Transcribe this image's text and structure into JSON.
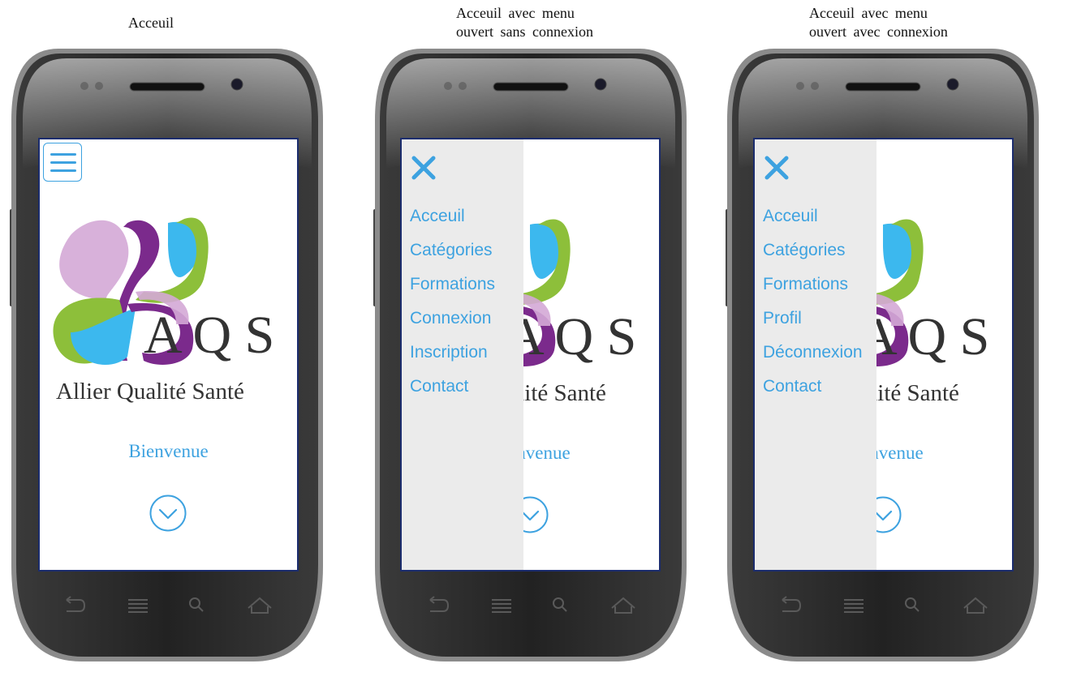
{
  "captions": {
    "screen1": [
      "Acceuil"
    ],
    "screen2": [
      "Acceuil avec menu",
      "ouvert sans connexion"
    ],
    "screen3": [
      "Acceuil avec menu",
      "ouvert avec connexion"
    ]
  },
  "app": {
    "logo_letters": "AQS",
    "logo_tagline": "Allier Qualité Santé",
    "welcome": "Bienvenue"
  },
  "menu_guest": [
    "Acceuil",
    "Catégories",
    "Formations",
    "Connexion",
    "Inscription",
    "Contact"
  ],
  "menu_user": [
    "Acceuil",
    "Catégories",
    "Formations",
    "Profil",
    "Déconnexion",
    "Contact"
  ],
  "colors": {
    "accent": "#3da2e0",
    "drawer_bg": "#ebebeb",
    "screen_border": "#1c2d6e",
    "logo_purple": "#7b2a8c",
    "logo_lilac": "#d4a9d6",
    "logo_blue": "#3cb8ee",
    "logo_green": "#8dbf3a"
  },
  "icons": {
    "menu": "hamburger-icon",
    "close": "close-icon",
    "scroll_down": "chevron-down-circle-icon",
    "nav_back": "back-icon",
    "nav_menu": "menu-lines-icon",
    "nav_search": "search-icon",
    "nav_home": "home-icon"
  }
}
